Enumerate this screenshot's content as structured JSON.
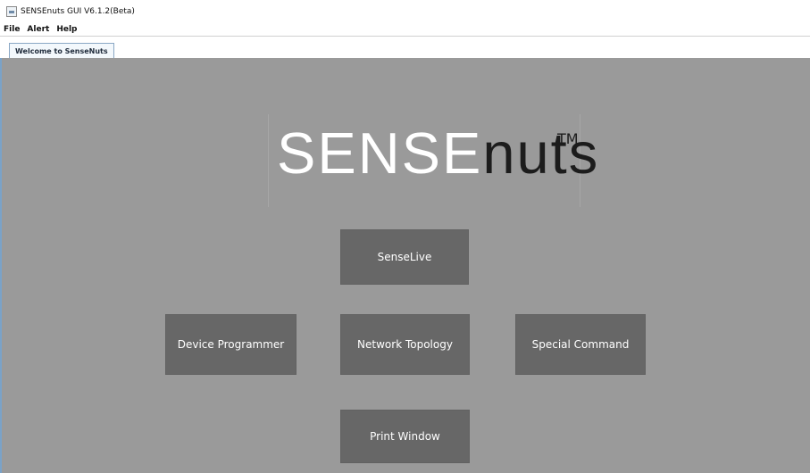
{
  "window": {
    "title": "SENSEnuts GUI V6.1.2(Beta)"
  },
  "menubar": {
    "items": [
      "File",
      "Alert",
      "Help"
    ]
  },
  "tabs": [
    {
      "label": "Welcome to SenseNuts"
    }
  ],
  "logo": {
    "part1": "SENSE",
    "part2": "nuts",
    "trademark": "TM"
  },
  "buttons": {
    "senselive": "SenseLive",
    "device_programmer": "Device Programmer",
    "network_topology": "Network Topology",
    "special_command": "Special Command",
    "print_window": "Print Window"
  },
  "colors": {
    "background": "#9a9a9a",
    "button": "#676767",
    "accent": "#7aa2c8"
  }
}
